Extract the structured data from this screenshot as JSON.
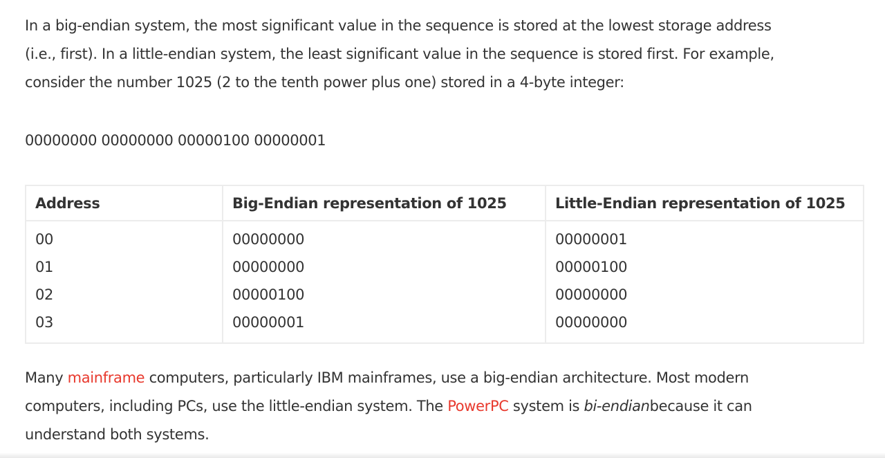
{
  "intro": {
    "line1": "In a big-endian system, the most significant value in the sequence is stored at the lowest storage address",
    "line2": "(i.e., first). In a little-endian system, the least significant value in the sequence is stored first. For example,",
    "line3": "consider the number 1025 (2 to the tenth power plus one) stored in a 4-byte integer:"
  },
  "binary_value": "00000000 00000000 00000100 00000001",
  "table": {
    "headers": [
      "Address",
      "Big-Endian representation of 1025",
      "Little-Endian representation of 1025"
    ],
    "rows": [
      [
        "00",
        "00000000",
        "00000001"
      ],
      [
        "01",
        "00000000",
        "00000100"
      ],
      [
        "02",
        "00000100",
        "00000000"
      ],
      [
        "03",
        "00000001",
        "00000000"
      ]
    ]
  },
  "outro": {
    "line1_pre": "Many ",
    "link_mainframe": "mainframe",
    "line1_post": " computers, particularly IBM mainframes, use a big-endian architecture. Most modern",
    "line2_pre": "computers, including PCs, use the little-endian system. The ",
    "link_powerpc": "PowerPC",
    "line2_mid": " system is ",
    "line2_em": "bi-endian",
    "line2_post": "because it can",
    "line3": "understand both systems."
  },
  "colors": {
    "text": "#333333",
    "link": "#e8392d",
    "table_border": "#ececec"
  }
}
